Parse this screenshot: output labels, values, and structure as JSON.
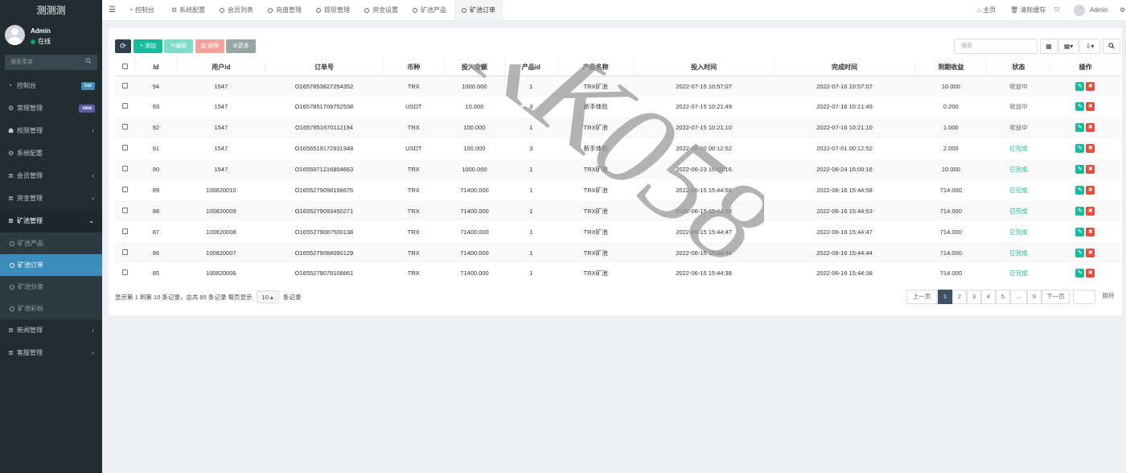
{
  "app": {
    "title": "测测测"
  },
  "user": {
    "name": "Admin",
    "status": "在线"
  },
  "sidebar": {
    "search_placeholder": "搜索菜单",
    "items": [
      {
        "label": "控制台",
        "icon": "dashboard-icon",
        "badge": "hot",
        "badge_color": "#3c8dbc"
      },
      {
        "label": "常规管理",
        "icon": "cogs-icon",
        "badge": "new",
        "badge_color": "#605ca8"
      },
      {
        "label": "权限管理",
        "icon": "group-icon"
      },
      {
        "label": "系统配置",
        "icon": "gear-icon"
      },
      {
        "label": "会员管理",
        "icon": "list-icon"
      },
      {
        "label": "资金管理",
        "icon": "list-icon"
      },
      {
        "label": "矿池管理",
        "icon": "list-icon"
      },
      {
        "label": "新闻管理",
        "icon": "list-icon"
      },
      {
        "label": "客服管理",
        "icon": "list-icon"
      }
    ],
    "submenu": [
      "矿池产品",
      "矿池订单",
      "矿池分类",
      "矿池彩标"
    ]
  },
  "topnav": {
    "tabs": [
      "控制台",
      "系统配置",
      "会员列表",
      "充值管理",
      "提现管理",
      "资金设置",
      "矿池产品",
      "矿池订单"
    ],
    "home": "主页",
    "clear_cache": "清除缓存",
    "admin": "Admin"
  },
  "toolbar": {
    "add": "添加",
    "edit": "编辑",
    "delete": "删除",
    "more": "更多",
    "search_placeholder": "搜索"
  },
  "table": {
    "headers": [
      "Id",
      "用户id",
      "订单号",
      "币种",
      "投入金额",
      "产品id",
      "产品名称",
      "投入时间",
      "完成时间",
      "到期收益",
      "状态",
      "操作"
    ],
    "rows": [
      [
        "94",
        "1547",
        "O1657853827254352",
        "TRX",
        "1000.000",
        "1",
        "TRX矿池",
        "2022-07-15 10:57:07",
        "2022-07-16 10:57:07",
        "10.000",
        "收益中"
      ],
      [
        "93",
        "1547",
        "O1657851709752538",
        "USDT",
        "10.000",
        "3",
        "新手体验",
        "2022-07-15 10:21:49",
        "2022-07-16 10:21:49",
        "0.200",
        "收益中"
      ],
      [
        "92",
        "1547",
        "O1657851670112194",
        "TRX",
        "100.000",
        "1",
        "TRX矿池",
        "2022-07-15 10:21:10",
        "2022-07-16 10:21:10",
        "1.000",
        "收益中"
      ],
      [
        "91",
        "1547",
        "O1656519172931948",
        "USDT",
        "100.000",
        "3",
        "新手体验",
        "2022-06-30 00:12:52",
        "2022-07-01 00:12:52",
        "2.000",
        "已完成"
      ],
      [
        "90",
        "1547",
        "O1655971216804663",
        "TRX",
        "1000.000",
        "1",
        "TRX矿池",
        "2022-06-23 16:00:16",
        "2022-06-24 16:00:16",
        "10.000",
        "已完成"
      ],
      [
        "89",
        "100820010",
        "O1655279098198676",
        "TRX",
        "71400.000",
        "1",
        "TRX矿池",
        "2022-06-15 15:44:58",
        "2022-06-16 15:44:58",
        "714.000",
        "已完成"
      ],
      [
        "88",
        "100820009",
        "O1655279093450271",
        "TRX",
        "71400.000",
        "1",
        "TRX矿池",
        "2022-06-15 15:44:53",
        "2022-06-16 15:44:53",
        "714.000",
        "已完成"
      ],
      [
        "87",
        "100820008",
        "O1655279087500138",
        "TRX",
        "71400.000",
        "1",
        "TRX矿池",
        "2022-06-15 15:44:47",
        "2022-06-16 15:44:47",
        "714.000",
        "已完成"
      ],
      [
        "86",
        "100820007",
        "O1655279084090129",
        "TRX",
        "71400.000",
        "1",
        "TRX矿池",
        "2022-06-15 15:44:44",
        "2022-06-16 15:44:44",
        "714.000",
        "已完成"
      ],
      [
        "85",
        "100820006",
        "O1655279078108861",
        "TRX",
        "71400.000",
        "1",
        "TRX矿池",
        "2022-06-15 15:44:38",
        "2022-06-16 15:44:38",
        "714.000",
        "已完成"
      ]
    ]
  },
  "footer": {
    "summary": "显示第 1 到第 10 条记录，总共 85 条记录 每页显示",
    "page_size": "10",
    "suffix": "条记录"
  },
  "pagination": {
    "prev": "上一页",
    "pages": [
      "1",
      "2",
      "3",
      "4",
      "5",
      "...",
      "9"
    ],
    "next": "下一页",
    "jump": "跳转"
  },
  "watermark": "KK058",
  "colors": {
    "sidebar_bg": "#222d32",
    "active_menu": "#3c8dbc",
    "done_status": "#18bc9c",
    "edit_btn": "#18bc9c",
    "delete_btn": "#e74c3c",
    "add_btn": "#18bc9c"
  }
}
